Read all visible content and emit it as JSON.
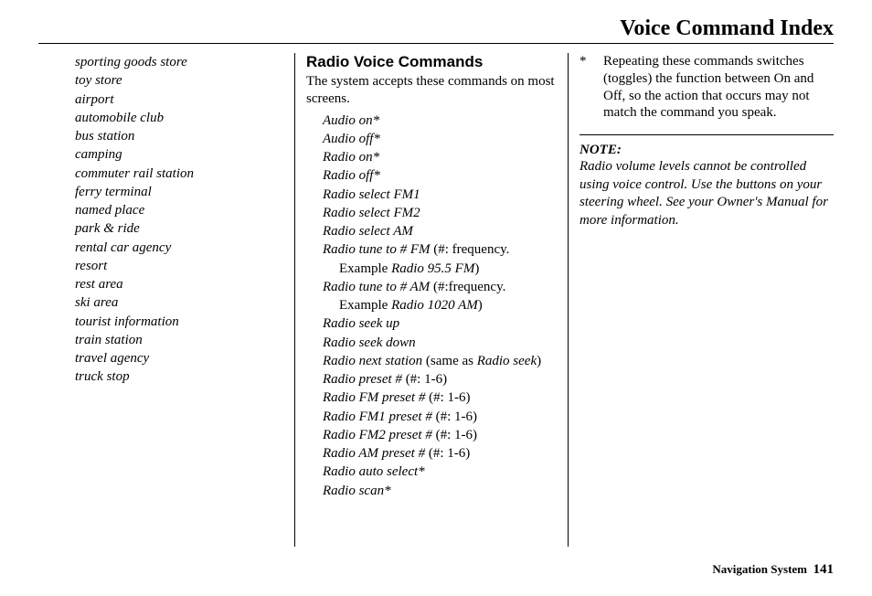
{
  "header": {
    "title": "Voice Command Index"
  },
  "footer": {
    "label": "Navigation System",
    "page": "141"
  },
  "col1": {
    "items": [
      "sporting goods store",
      "toy store",
      "airport",
      "automobile club",
      "bus station",
      "camping",
      "commuter rail station",
      "ferry terminal",
      "named place",
      "park & ride",
      "rental car agency",
      "resort",
      "rest area",
      "ski area",
      "tourist information",
      "train station",
      "travel agency",
      "truck stop"
    ]
  },
  "col2": {
    "heading": "Radio Voice Commands",
    "intro": "The system accepts these commands on most screens.",
    "cmds": {
      "c1": "Audio on*",
      "c2": "Audio off*",
      "c3": "Radio on*",
      "c4": "Radio off*",
      "c5": "Radio select FM1",
      "c6": "Radio select FM2",
      "c7": "Radio select AM",
      "c8a": "Radio tune to # FM",
      "c8b": " (#: frequency. Example ",
      "c8c": "Radio 95.5 FM",
      "c8d": ")",
      "c9a": "Radio tune to # AM",
      "c9b": " (#:frequency. Example ",
      "c9c": "Radio 1020 AM",
      "c9d": ")",
      "c10": "Radio seek up",
      "c11": "Radio seek down",
      "c12a": "Radio next station",
      "c12b": " (same as ",
      "c12c": "Radio seek",
      "c12d": ")",
      "c13a": "Radio preset #",
      "c13b": " (#: 1-6)",
      "c14a": "Radio FM preset #",
      "c14b": " (#: 1-6)",
      "c15a": "Radio FM1 preset #",
      "c15b": " (#: 1-6)",
      "c16a": "Radio FM2 preset #",
      "c16b": " (#: 1-6)",
      "c17a": "Radio AM preset #",
      "c17b": " (#: 1-6)",
      "c18": "Radio auto select*",
      "c19": "Radio scan*"
    }
  },
  "col3": {
    "star": "*",
    "star_note": "Repeating these commands switches (toggles) the function between On and Off, so the action that occurs may not match the command you speak.",
    "note_heading": "NOTE:",
    "note_body": "Radio volume levels cannot be controlled using voice control. Use the buttons on your steering wheel. See your Owner's Manual for more information."
  }
}
